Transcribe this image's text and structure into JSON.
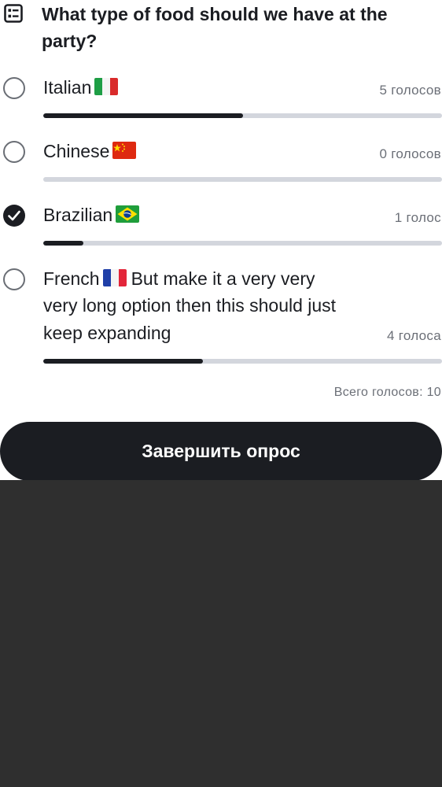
{
  "poll": {
    "question": "What type of food should we have at the party?",
    "icon": "poll-list-icon",
    "options": [
      {
        "label": "Italian",
        "flag": "italy-flag-icon",
        "votes_label": "5 голосов",
        "votes": 5,
        "share": 0.5,
        "selected": false
      },
      {
        "label": "Chinese",
        "flag": "china-flag-icon",
        "votes_label": "0 голосов",
        "votes": 0,
        "share": 0.0,
        "selected": false
      },
      {
        "label": "Brazilian",
        "flag": "brazil-flag-icon",
        "votes_label": "1 голос",
        "votes": 1,
        "share": 0.1,
        "selected": true
      },
      {
        "label_before_flag": "French",
        "flag": "france-flag-icon",
        "label_line1_rest": "But make it a very very",
        "label_line2": "very long option then this should just",
        "label_line3": "keep expanding",
        "votes_label": "4 голоса",
        "votes": 4,
        "share": 0.4,
        "selected": false
      }
    ],
    "total_label": "Всего голосов: 10",
    "end_button_label": "Завершить опрос"
  },
  "colors": {
    "text": "#1b1d22",
    "muted": "#6b6f77",
    "track": "#d3d6dd",
    "fill": "#1b1d22",
    "button_bg": "#1b1d22",
    "button_text": "#ffffff",
    "background_below": "#2f2f2f"
  }
}
